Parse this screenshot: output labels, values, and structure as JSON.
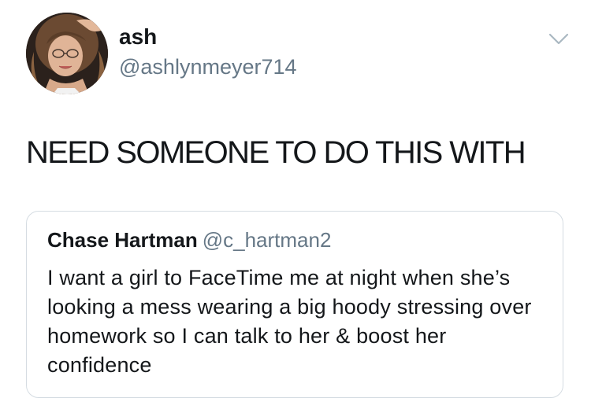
{
  "tweet": {
    "author": {
      "display_name": "ash",
      "handle": "@ashlynmeyer714"
    },
    "text": "NEED SOMEONE TO DO THIS WITH",
    "menu_icon": "chevron-down-icon",
    "quoted_tweet": {
      "author_name": "Chase Hartman",
      "author_handle": "@c_hartman2",
      "text": "I want a girl to FaceTime me at night when she’s looking a mess wearing a big hoody stressing over homework so I can talk to her & boost her confidence"
    }
  },
  "colors": {
    "primary_text": "#14171a",
    "secondary_text": "#657786",
    "border": "#d5dce2",
    "caret": "#aab8c2"
  }
}
